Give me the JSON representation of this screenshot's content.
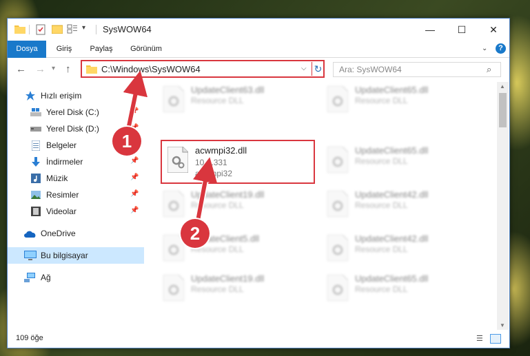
{
  "window": {
    "title": "SysWOW64"
  },
  "ribbon": {
    "tabs": [
      "Dosya",
      "Giriş",
      "Paylaş",
      "Görünüm"
    ],
    "help": "?"
  },
  "navigation": {
    "address_path": "C:\\Windows\\SysWOW64",
    "search_placeholder": "Ara: SysWOW64"
  },
  "sidebar": {
    "items": [
      {
        "label": "Hızlı erişim",
        "icon": "star-icon"
      },
      {
        "label": "Yerel Disk (C:)",
        "icon": "windows-drive-icon"
      },
      {
        "label": "Yerel Disk (D:)",
        "icon": "drive-icon"
      },
      {
        "label": "Belgeler",
        "icon": "documents-icon"
      },
      {
        "label": "İndirmeler",
        "icon": "download-icon"
      },
      {
        "label": "Müzik",
        "icon": "music-icon"
      },
      {
        "label": "Resimler",
        "icon": "pictures-icon"
      },
      {
        "label": "Videolar",
        "icon": "videos-icon"
      },
      {
        "label": "OneDrive",
        "icon": "onedrive-icon"
      },
      {
        "label": "Bu bilgisayar",
        "icon": "computer-icon"
      },
      {
        "label": "Ağ",
        "icon": "network-icon"
      }
    ]
  },
  "files": [
    {
      "name": "UpdateClient63.dll",
      "line1": "Resource DLL",
      "line2": ""
    },
    {
      "name": "UpdateClient65.dll",
      "line1": "Resource DLL",
      "line2": ""
    },
    {
      "name": "acwmpi32.dll",
      "line1": "10.1.331",
      "line2": "acwmpi32"
    },
    {
      "name": "UpdateClient65.dll",
      "line1": "Resource DLL",
      "line2": ""
    },
    {
      "name": "UpdateClient19.dll",
      "line1": "Resource DLL",
      "line2": ""
    },
    {
      "name": "UpdateClient42.dll",
      "line1": "Resource DLL",
      "line2": ""
    },
    {
      "name": "UpdateClient5.dll",
      "line1": "Resource DLL",
      "line2": ""
    },
    {
      "name": "UpdateClient42.dll",
      "line1": "Resource DLL",
      "line2": ""
    },
    {
      "name": "UpdateClient19.dll",
      "line1": "Resource DLL",
      "line2": ""
    },
    {
      "name": "UpdateClient65.dll",
      "line1": "Resource DLL",
      "line2": ""
    }
  ],
  "status": {
    "item_count": "109 öğe"
  },
  "annotations": {
    "step1": "1",
    "step2": "2",
    "color": "#d9363e"
  }
}
